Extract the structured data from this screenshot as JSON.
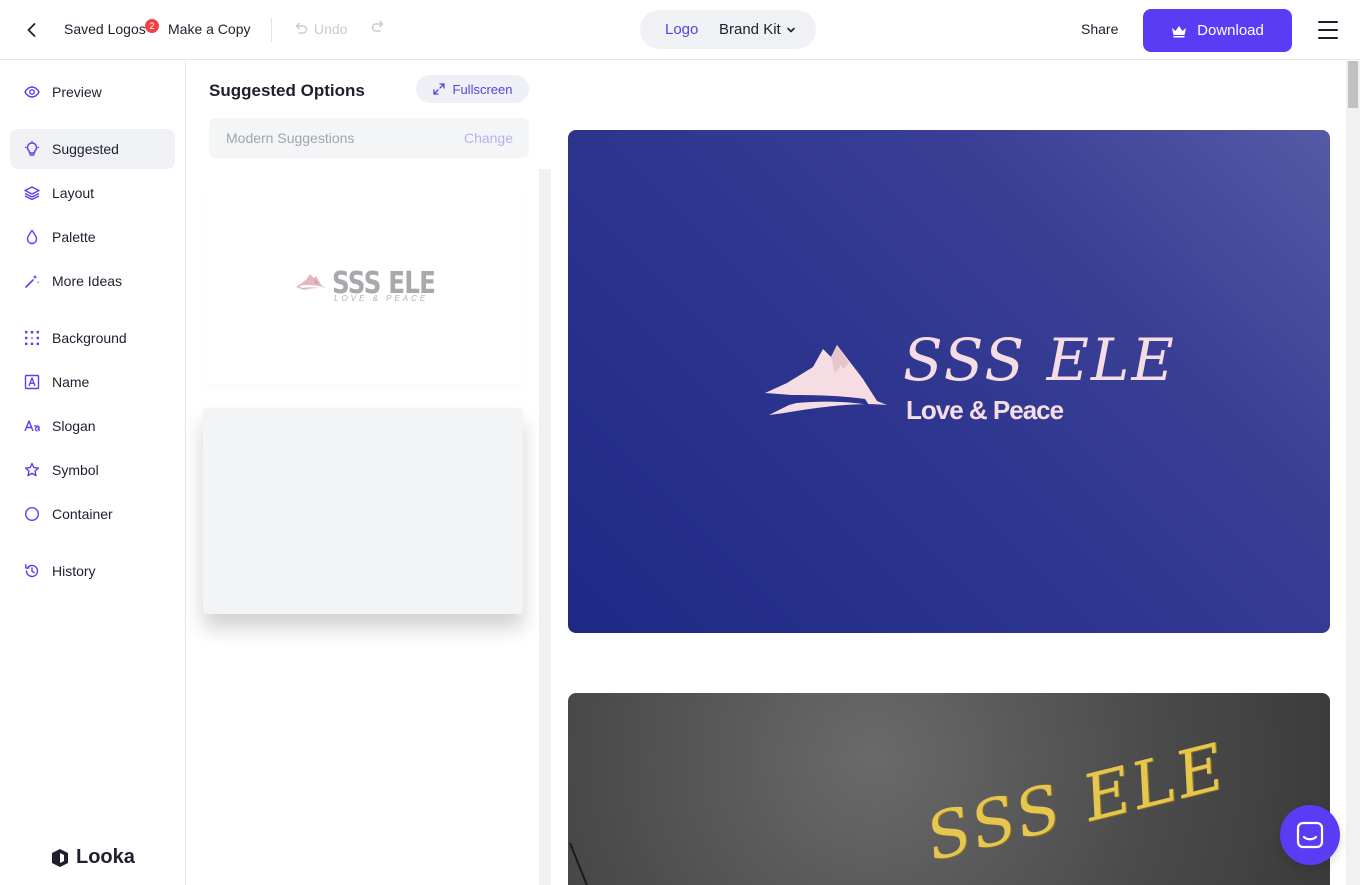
{
  "header": {
    "saved_logos": "Saved Logos",
    "saved_count": "2",
    "make_copy": "Make a Copy",
    "undo": "Undo",
    "mode_logo": "Logo",
    "mode_brand_kit": "Brand Kit",
    "share": "Share",
    "download": "Download",
    "accent": "#5b3cf5"
  },
  "sidebar": {
    "items": [
      {
        "label": "Preview",
        "icon": "eye-icon"
      },
      {
        "label": "Suggested",
        "icon": "lightbulb-icon",
        "active": true
      },
      {
        "label": "Layout",
        "icon": "layers-icon"
      },
      {
        "label": "Palette",
        "icon": "droplet-icon"
      },
      {
        "label": "More Ideas",
        "icon": "magic-wand-icon"
      },
      {
        "label": "Background",
        "icon": "dot-grid-icon"
      },
      {
        "label": "Name",
        "icon": "text-a-icon"
      },
      {
        "label": "Slogan",
        "icon": "font-aa-icon"
      },
      {
        "label": "Symbol",
        "icon": "star-icon"
      },
      {
        "label": "Container",
        "icon": "circle-icon"
      },
      {
        "label": "History",
        "icon": "history-icon"
      }
    ],
    "brand": "Looka"
  },
  "panel": {
    "title": "Suggested Options",
    "fullscreen": "Fullscreen",
    "suggestions_label": "Modern Suggestions",
    "change": "Change",
    "option1": {
      "name": "SSS ELE",
      "slogan": "LOVE & PEACE"
    }
  },
  "preview": {
    "logo_name": "SSS ELE",
    "slogan": "Love & Peace",
    "card_color": "#2c348e",
    "logo_color": "#f6dde4"
  }
}
